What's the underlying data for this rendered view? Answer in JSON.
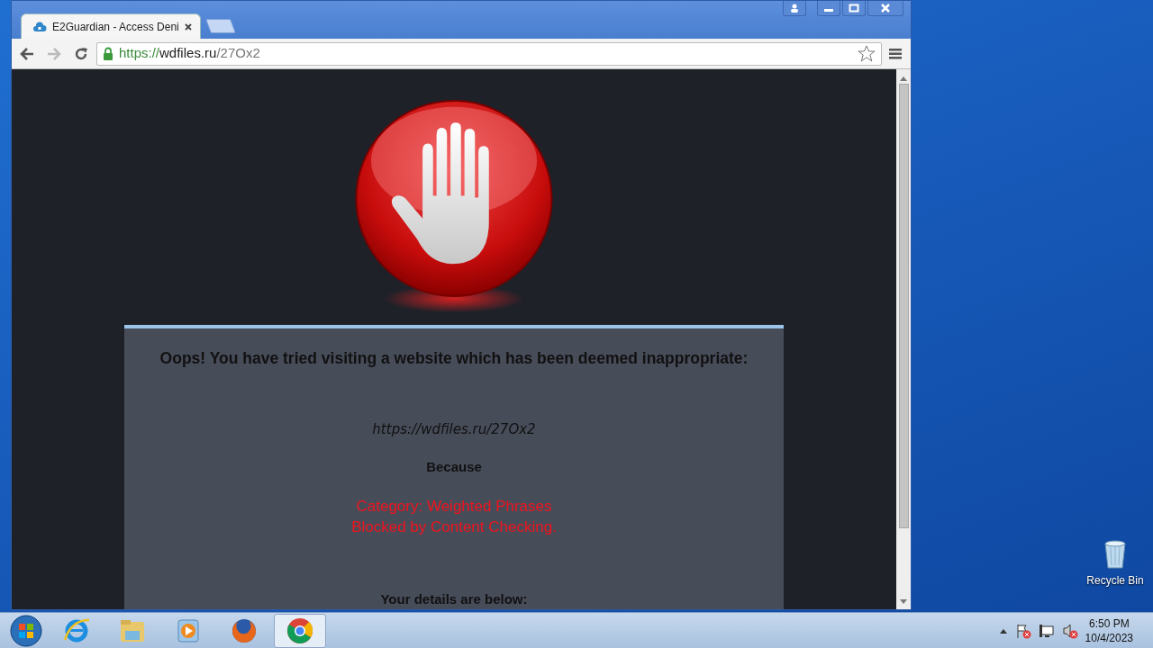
{
  "browser": {
    "tabs": [
      {
        "title": "E2Guardian - Access Deni",
        "selected": true
      }
    ],
    "address_bar": {
      "scheme": "https://",
      "host": "wdfiles.ru",
      "path": "/27Ox2",
      "secure": true
    }
  },
  "page": {
    "heading": "Oops! You have tried visiting a website which has been deemed inappropriate:",
    "blocked_url": "https://wdfiles.ru/27Ox2",
    "because": "Because",
    "reasons": [
      "Category: Weighted Phrases",
      "Blocked by Content Checking."
    ],
    "details_heading": "Your details are below:"
  },
  "desktop": {
    "icons": [
      {
        "label": "Recycle Bin"
      }
    ]
  },
  "taskbar": {
    "apps": [
      {
        "kind": "ie",
        "selected": false
      },
      {
        "kind": "folder",
        "selected": false
      },
      {
        "kind": "media",
        "selected": false
      },
      {
        "kind": "firefox",
        "selected": false
      },
      {
        "kind": "chrome",
        "selected": true
      }
    ],
    "clock": {
      "time": "6:50 PM",
      "date": "10/4/2023"
    }
  }
}
